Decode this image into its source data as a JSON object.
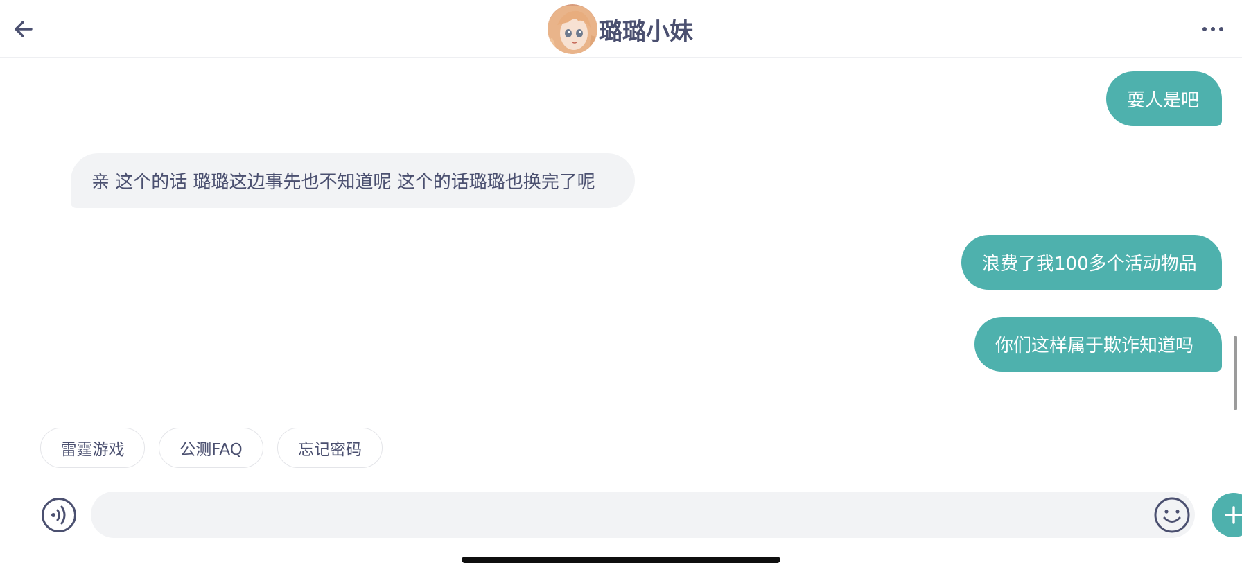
{
  "header": {
    "back_icon": "arrow-left-icon",
    "title": "璐璐小妹",
    "avatar_icon": "anime-girl-avatar",
    "more_icon": "ellipsis-horizontal-icon"
  },
  "messages": [
    {
      "direction": "outgoing",
      "text": "耍人是吧"
    },
    {
      "direction": "incoming",
      "text": "亲 这个的话 璐璐这边事先也不知道呢 这个的话璐璐也换完了呢"
    },
    {
      "direction": "outgoing",
      "text": "浪费了我100多个活动物品"
    },
    {
      "direction": "outgoing",
      "text": "你们这样属于欺诈知道吗"
    }
  ],
  "quick_replies": [
    "雷霆游戏",
    "公测FAQ",
    "忘记密码"
  ],
  "composer": {
    "voice_icon": "voice-wave-icon",
    "input_value": "",
    "input_placeholder": "",
    "emoji_icon": "smiley-face-icon",
    "plus_icon": "plus-icon"
  },
  "colors": {
    "accent": "#4eb1ad",
    "text": "#4b5070",
    "bubble_incoming": "#f2f3f5",
    "border": "#eeeff2"
  }
}
